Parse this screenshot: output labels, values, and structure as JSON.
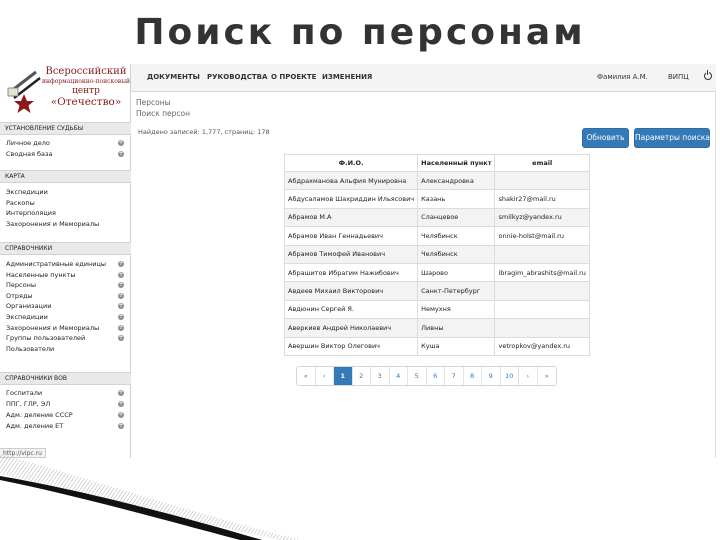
{
  "slide": {
    "title": "Поиск по персонам"
  },
  "logo": {
    "line1": "Всероссийский",
    "line2": "информационно-поисковый",
    "line3": "центр",
    "line4": "«Отечество»"
  },
  "sidebar": {
    "sections": [
      {
        "title": "УСТАНОВЛЕНИЕ СУДЬБЫ",
        "items": [
          {
            "label": "Личное дело",
            "plus": true
          },
          {
            "label": "Сводная база",
            "plus": true
          }
        ]
      },
      {
        "title": "КАРТА",
        "items": [
          {
            "label": "Экспедиции",
            "plus": false
          },
          {
            "label": "Раскопы",
            "plus": false
          },
          {
            "label": "Интерполяция",
            "plus": false
          },
          {
            "label": "Захоронения и Мемориалы",
            "plus": false
          }
        ]
      },
      {
        "title": "СПРАВОЧНИКИ",
        "items": [
          {
            "label": "Административные единицы",
            "plus": true
          },
          {
            "label": "Населенные пункты",
            "plus": true
          },
          {
            "label": "Персоны",
            "plus": true
          },
          {
            "label": "Отряды",
            "plus": true
          },
          {
            "label": "Организации",
            "plus": true
          },
          {
            "label": "Экспедиции",
            "plus": true
          },
          {
            "label": "Захоронения и Мемориалы",
            "plus": true
          },
          {
            "label": "Группы пользователей",
            "plus": true
          },
          {
            "label": "Пользователи",
            "plus": false
          }
        ]
      },
      {
        "title": "СПРАВОЧНИКИ ВОВ",
        "items": [
          {
            "label": "Госпитали",
            "plus": true
          },
          {
            "label": "ППГ, ГЛР, ЭЛ",
            "plus": true
          },
          {
            "label": "Адм. деление СССР",
            "plus": true
          },
          {
            "label": "Адм. деление ЕТ",
            "plus": true
          }
        ]
      }
    ]
  },
  "nav": {
    "items": [
      "ДОКУМЕНТЫ",
      "РУКОВОДСТВА",
      "О ПРОЕКТЕ",
      "ИЗМЕНЕНИЯ"
    ],
    "user": "Фамилия А.М.",
    "org": "ВИПЦ"
  },
  "main": {
    "breadcrumb1": "Персоны",
    "breadcrumb2": "Поиск персон",
    "found_text": "Найдено записей: 1,777, страниц: 178",
    "refresh_button": "Обновить",
    "params_button": "Параметры поиска",
    "table": {
      "headers": [
        "Ф.И.О.",
        "Населенный пункт",
        "email"
      ],
      "rows": [
        [
          "Абдрахманова Альфия Мунировна",
          "Александровка",
          ""
        ],
        [
          "Абдусаламов Шахриддин Ильясович",
          "Казань",
          "shakir27@mail.ru"
        ],
        [
          "Абрамов М.А",
          "Сланцевое",
          "smilkyz@yandex.ru"
        ],
        [
          "Абрамов Иван Геннадьевич",
          "Челябинск",
          "onnie-holst@mail.ru"
        ],
        [
          "Абрамов Тимофей Иванович",
          "Челябинск",
          ""
        ],
        [
          "Абрашитов Ибрагим Нажибович",
          "Шарово",
          "ibragim_abrashits@mail.ru"
        ],
        [
          "Авдеев Михаил Викторович",
          "Санкт-Петербург",
          ""
        ],
        [
          "Авдюнин Сергей Я.",
          "Немухня",
          ""
        ],
        [
          "Аверкиев Андрей Николаевич",
          "Ливны",
          ""
        ],
        [
          "Авершин Виктор Олегович",
          "Куша",
          "vetropkov@yandex.ru"
        ]
      ]
    },
    "pagination": [
      "«",
      "‹",
      "1",
      "2",
      "3",
      "4",
      "5",
      "6",
      "7",
      "8",
      "9",
      "10",
      "›",
      "»"
    ],
    "active_page": "1"
  },
  "statusbar": {
    "url": "http://vipc.ru"
  },
  "colors": {
    "accent": "#337ab7",
    "logo": "#8b1a1a"
  }
}
